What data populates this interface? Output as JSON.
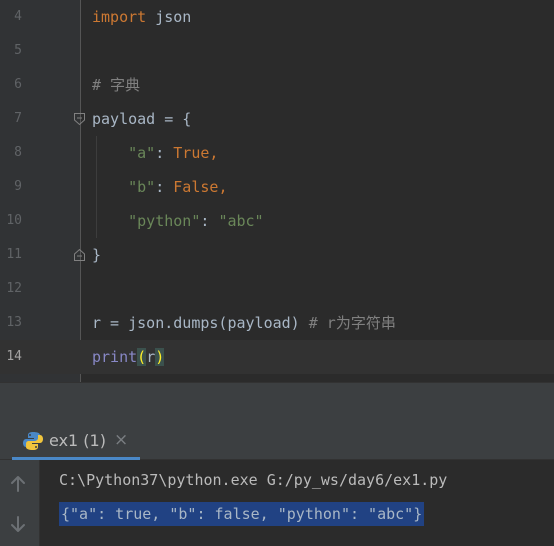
{
  "editor": {
    "lines": [
      {
        "num": "4",
        "tokens": [
          {
            "t": "import",
            "c": "kw"
          },
          {
            "t": " json",
            "c": ""
          }
        ]
      },
      {
        "num": "5",
        "tokens": []
      },
      {
        "num": "6",
        "tokens": [
          {
            "t": "# 字典",
            "c": "comment"
          }
        ]
      },
      {
        "num": "7",
        "tokens": [
          {
            "t": "payload = {",
            "c": ""
          }
        ],
        "fold": "open"
      },
      {
        "num": "8",
        "tokens": [
          {
            "t": "    ",
            "c": ""
          },
          {
            "t": "\"a\"",
            "c": "str"
          },
          {
            "t": ": ",
            "c": ""
          },
          {
            "t": "True",
            "c": "kw"
          },
          {
            "t": ",",
            "c": "punct"
          }
        ]
      },
      {
        "num": "9",
        "tokens": [
          {
            "t": "    ",
            "c": ""
          },
          {
            "t": "\"b\"",
            "c": "str"
          },
          {
            "t": ": ",
            "c": ""
          },
          {
            "t": "False",
            "c": "kw"
          },
          {
            "t": ",",
            "c": "punct"
          }
        ]
      },
      {
        "num": "10",
        "tokens": [
          {
            "t": "    ",
            "c": ""
          },
          {
            "t": "\"python\"",
            "c": "str"
          },
          {
            "t": ": ",
            "c": ""
          },
          {
            "t": "\"abc\"",
            "c": "str"
          }
        ]
      },
      {
        "num": "11",
        "tokens": [
          {
            "t": "}",
            "c": ""
          }
        ],
        "fold": "close"
      },
      {
        "num": "12",
        "tokens": []
      },
      {
        "num": "13",
        "tokens": [
          {
            "t": "r = json.dumps(payload) ",
            "c": ""
          },
          {
            "t": "# r为字符串",
            "c": "comment"
          }
        ]
      },
      {
        "num": "14",
        "tokens": [
          {
            "t": "print",
            "c": "builtin"
          },
          {
            "t": "(",
            "c": "brace-match"
          },
          {
            "t": "r",
            "c": ""
          },
          {
            "t": ")",
            "c": "brace-match"
          }
        ],
        "current": true
      }
    ]
  },
  "run": {
    "tab_label": "ex1 (1)",
    "tab_close": "×",
    "command": "C:\\Python37\\python.exe G:/py_ws/day6/ex1.py",
    "output": "{\"a\": true, \"b\": false, \"python\": \"abc\"}"
  },
  "colors": {
    "background": "#2b2b2b",
    "keyword": "#cc7832",
    "string": "#6a8759",
    "comment": "#808080",
    "builtin": "#8888c6",
    "selection": "#214283"
  }
}
